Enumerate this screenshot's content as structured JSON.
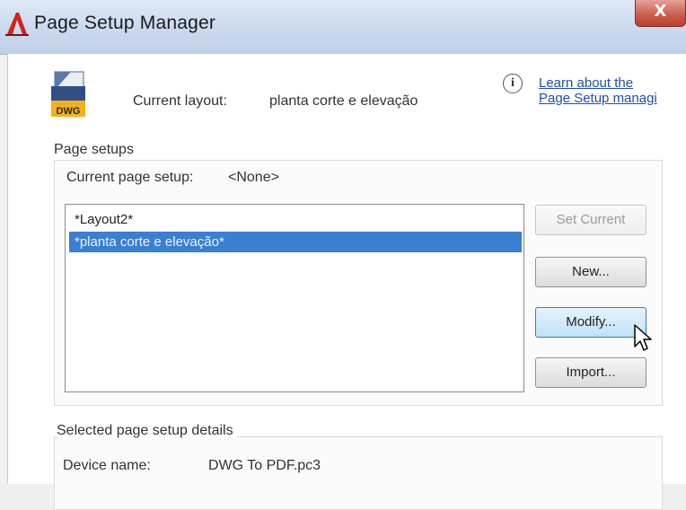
{
  "window": {
    "title": "Page Setup Manager",
    "app_icon": "autocad-logo-icon",
    "close_glyph": "X"
  },
  "header": {
    "file_icon": "dwg-file-icon",
    "file_icon_text": "DWG",
    "current_layout_label": "Current layout:",
    "current_layout_value": "planta corte e elevação",
    "info_icon": "info-icon",
    "info_glyph": "i",
    "help_link_line1": "Learn about the",
    "help_link_line2": "Page Setup managi"
  },
  "page_setups": {
    "group_label": "Page setups",
    "current_label": "Current page setup:",
    "current_value": "<None>",
    "items": [
      {
        "label": "*Layout2*",
        "selected": false
      },
      {
        "label": "*planta corte e elevação*",
        "selected": true
      }
    ],
    "buttons": {
      "set_current": "Set Current",
      "new": "New...",
      "modify": "Modify...",
      "import": "Import..."
    }
  },
  "details": {
    "group_label": "Selected page setup details",
    "device_name_label": "Device name:",
    "device_name_value": "DWG To PDF.pc3"
  },
  "colors": {
    "selection": "#3a7fd0",
    "link": "#1f4fa8",
    "close_button": "#c75a4a",
    "title_bar": "#c9d9ee"
  },
  "pointer": "arrow-cursor-icon"
}
